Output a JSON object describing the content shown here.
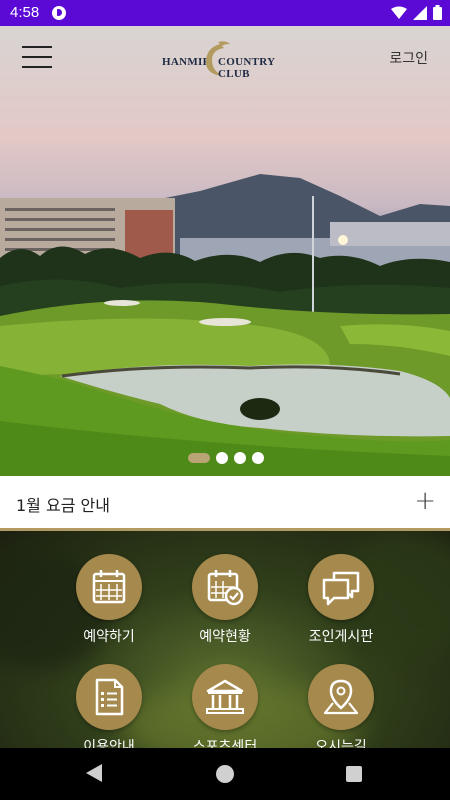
{
  "status": {
    "time": "4:58"
  },
  "header": {
    "logo_left": "HANMIR",
    "logo_right": "COUNTRY CLUB",
    "login_label": "로그인"
  },
  "hero": {
    "slide_count": 4,
    "active_slide": 1
  },
  "notice": {
    "title": "1월 요금 안내",
    "expand_symbol": "+"
  },
  "menu": [
    {
      "label": "예약하기",
      "icon": "calendar-icon"
    },
    {
      "label": "예약현황",
      "icon": "calendar-check-icon"
    },
    {
      "label": "조인게시판",
      "icon": "chat-bubbles-icon"
    },
    {
      "label": "이용안내",
      "icon": "document-list-icon"
    },
    {
      "label": "스포츠센터",
      "icon": "building-icon"
    },
    {
      "label": "오시는길",
      "icon": "map-pin-icon"
    }
  ],
  "colors": {
    "status_bar": "#5b0ad6",
    "accent_gold": "#a68a4d",
    "divider_gold": "#b39a63"
  }
}
